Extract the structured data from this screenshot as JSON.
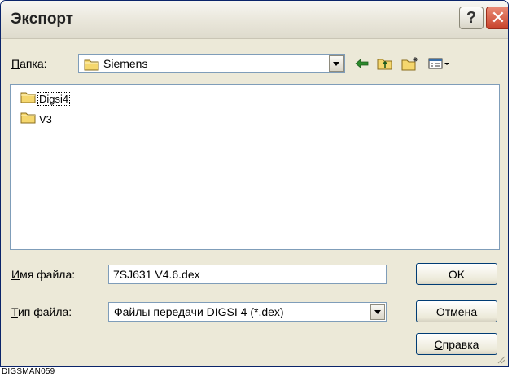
{
  "window": {
    "title": "Экспорт",
    "help_glyph": "?",
    "close_glyph": "✕"
  },
  "folder_bar": {
    "label_accel": "П",
    "label_rest": "апка:",
    "current_folder": "Siemens",
    "icons": [
      "back-icon",
      "up-folder-icon",
      "new-folder-icon",
      "view-menu-icon"
    ]
  },
  "file_list": {
    "items": [
      {
        "name": "Digsi4",
        "icon": "folder-icon",
        "selected": true
      },
      {
        "name": "V3",
        "icon": "folder-icon",
        "selected": false
      }
    ]
  },
  "filename": {
    "label_accel": "И",
    "label_rest": "мя файла:",
    "value": "7SJ631 V4.6.dex"
  },
  "filetype": {
    "label_accel": "Т",
    "label_rest": "ип файла:",
    "value": "Файлы передачи DIGSI 4 (*.dex)"
  },
  "buttons": {
    "ok": "OK",
    "cancel": "Отмена",
    "help_accel": "С",
    "help_rest": "правка"
  },
  "footer": {
    "caption": "DIGSMAN059"
  },
  "colors": {
    "dialog_bg": "#ece9d8",
    "field_border": "#7f9db9",
    "folder_yellow": "#f5d76e",
    "close_red": "#c8432c"
  }
}
